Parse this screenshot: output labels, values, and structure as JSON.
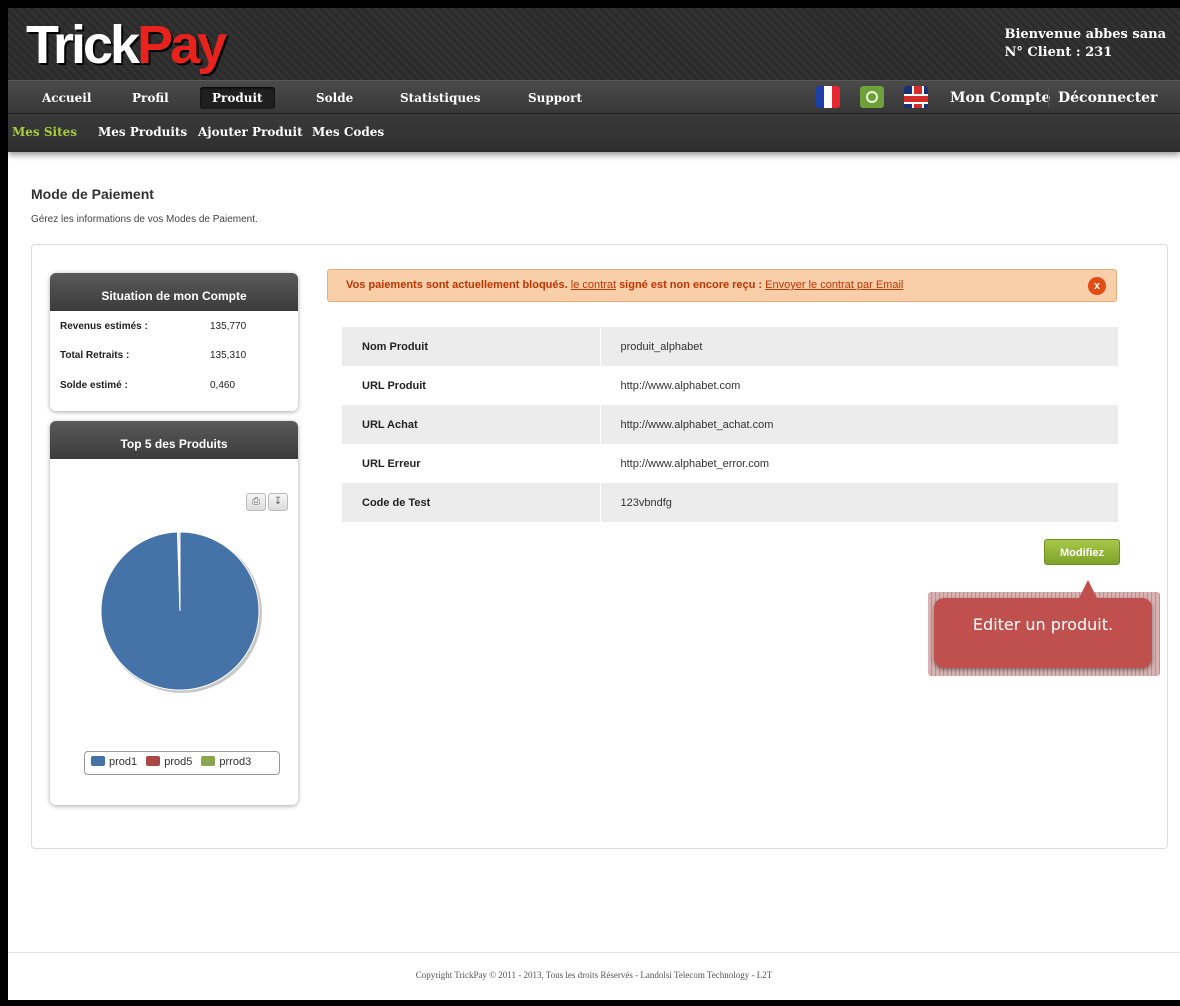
{
  "brand": {
    "logo_part1": "Trick",
    "logo_part2": "Pay"
  },
  "user": {
    "welcome": "Bienvenue abbes sana",
    "client": "N° Client : 231"
  },
  "main_nav": [
    "Accueil",
    "Profil",
    "Produit",
    "Solde",
    "Statistiques",
    "Support"
  ],
  "main_nav_active": "Produit",
  "right_nav": {
    "account": "Mon Compte",
    "logout": "Déconnecter"
  },
  "sub_nav": [
    "Mes Sites",
    "Mes Produits",
    "Ajouter Produit",
    "Mes Codes"
  ],
  "sub_nav_active": "Mes Sites",
  "page": {
    "title": "Mode de Paiement",
    "subtitle": "Gérez les informations de vos Modes de Paiement."
  },
  "account_widget": {
    "title": "Situation de mon Compte",
    "rows": [
      {
        "label": "Revenus estimés :",
        "value": "135,770"
      },
      {
        "label": "Total Retraits :",
        "value": "135,310"
      },
      {
        "label": "Solde estimé :",
        "value": "0,460"
      }
    ]
  },
  "top5_widget": {
    "title": "Top 5 des Produits"
  },
  "chart_data": {
    "type": "pie",
    "title": "",
    "slices": [
      {
        "name": "prod1",
        "value": 99.5,
        "color": "#4572a7"
      },
      {
        "name": "prod5",
        "value": 0.25,
        "color": "#aa4643"
      },
      {
        "name": "prrod3",
        "value": 0.25,
        "color": "#89a54e"
      }
    ],
    "legend_position": "bottom"
  },
  "alert": {
    "part1": "Vos paiements sont actuellement bloqués.",
    "link1": "le contrat",
    "part2": "signé est non encore reçu :",
    "link2": "Envoyer le contrat par Email",
    "close": "x"
  },
  "product": [
    {
      "label": "Nom Produit",
      "value": "produit_alphabet"
    },
    {
      "label": "URL Produit",
      "value": "http://www.alphabet.com"
    },
    {
      "label": "URL Achat",
      "value": "http://www.alphabet_achat.com"
    },
    {
      "label": "URL Erreur",
      "value": "http://www.alphabet_error.com"
    },
    {
      "label": "Code de Test",
      "value": "123vbndfg"
    }
  ],
  "modify_button": "Modifiez",
  "callout": "Editer un produit.",
  "footer": "Copyright TrickPay © 2011 - 2013, Tous les droits Réservés - Landolsi Telecom Technology - L2T",
  "colors": {
    "accent_green": "#a6cf3b",
    "alert_bg": "#f9cfaa",
    "alert_text": "#c03400",
    "button_green": "#8bb033",
    "callout_red": "#c0504d"
  }
}
